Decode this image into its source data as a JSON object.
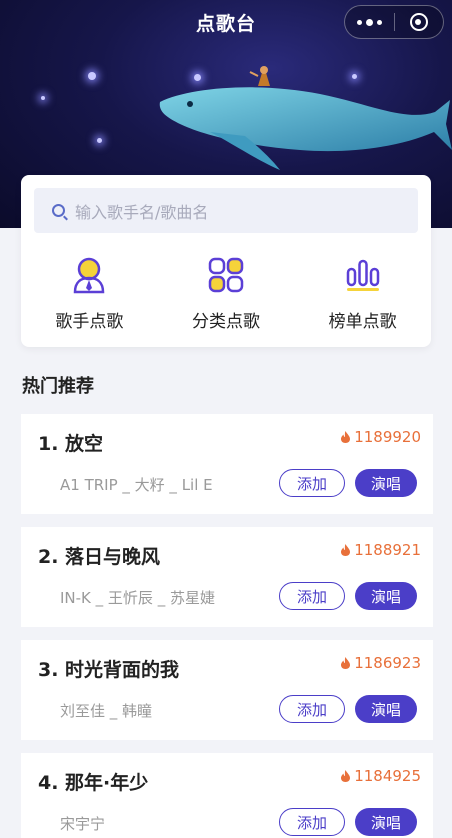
{
  "header": {
    "title": "点歌台",
    "capsule": {
      "more_icon": "more-dots-icon",
      "close_icon": "target-circle-icon"
    }
  },
  "search": {
    "placeholder": "输入歌手名/歌曲名",
    "icon": "search-icon"
  },
  "categories": [
    {
      "label": "歌手点歌",
      "icon": "singer-icon"
    },
    {
      "label": "分类点歌",
      "icon": "category-grid-icon"
    },
    {
      "label": "榜单点歌",
      "icon": "chart-bars-icon"
    }
  ],
  "section": {
    "title": "热门推荐"
  },
  "songs": [
    {
      "rank_title": "1. 放空",
      "heat": "1189920",
      "artist": "A1 TRIP _ 大籽 _ Lil E",
      "add_label": "添加",
      "sing_label": "演唱"
    },
    {
      "rank_title": "2. 落日与晚风",
      "heat": "1188921",
      "artist": "IN-K _ 王忻辰 _ 苏星婕",
      "add_label": "添加",
      "sing_label": "演唱"
    },
    {
      "rank_title": "3. 时光背面的我",
      "heat": "1186923",
      "artist": "刘至佳 _ 韩瞳",
      "add_label": "添加",
      "sing_label": "演唱"
    },
    {
      "rank_title": "4. 那年·年少",
      "heat": "1184925",
      "artist": "宋宇宁",
      "add_label": "添加",
      "sing_label": "演唱"
    }
  ],
  "colors": {
    "accent": "#4b3ec8",
    "heat": "#e8703a",
    "icon_purple": "#5b3fd6",
    "icon_yellow": "#f5d33a"
  }
}
